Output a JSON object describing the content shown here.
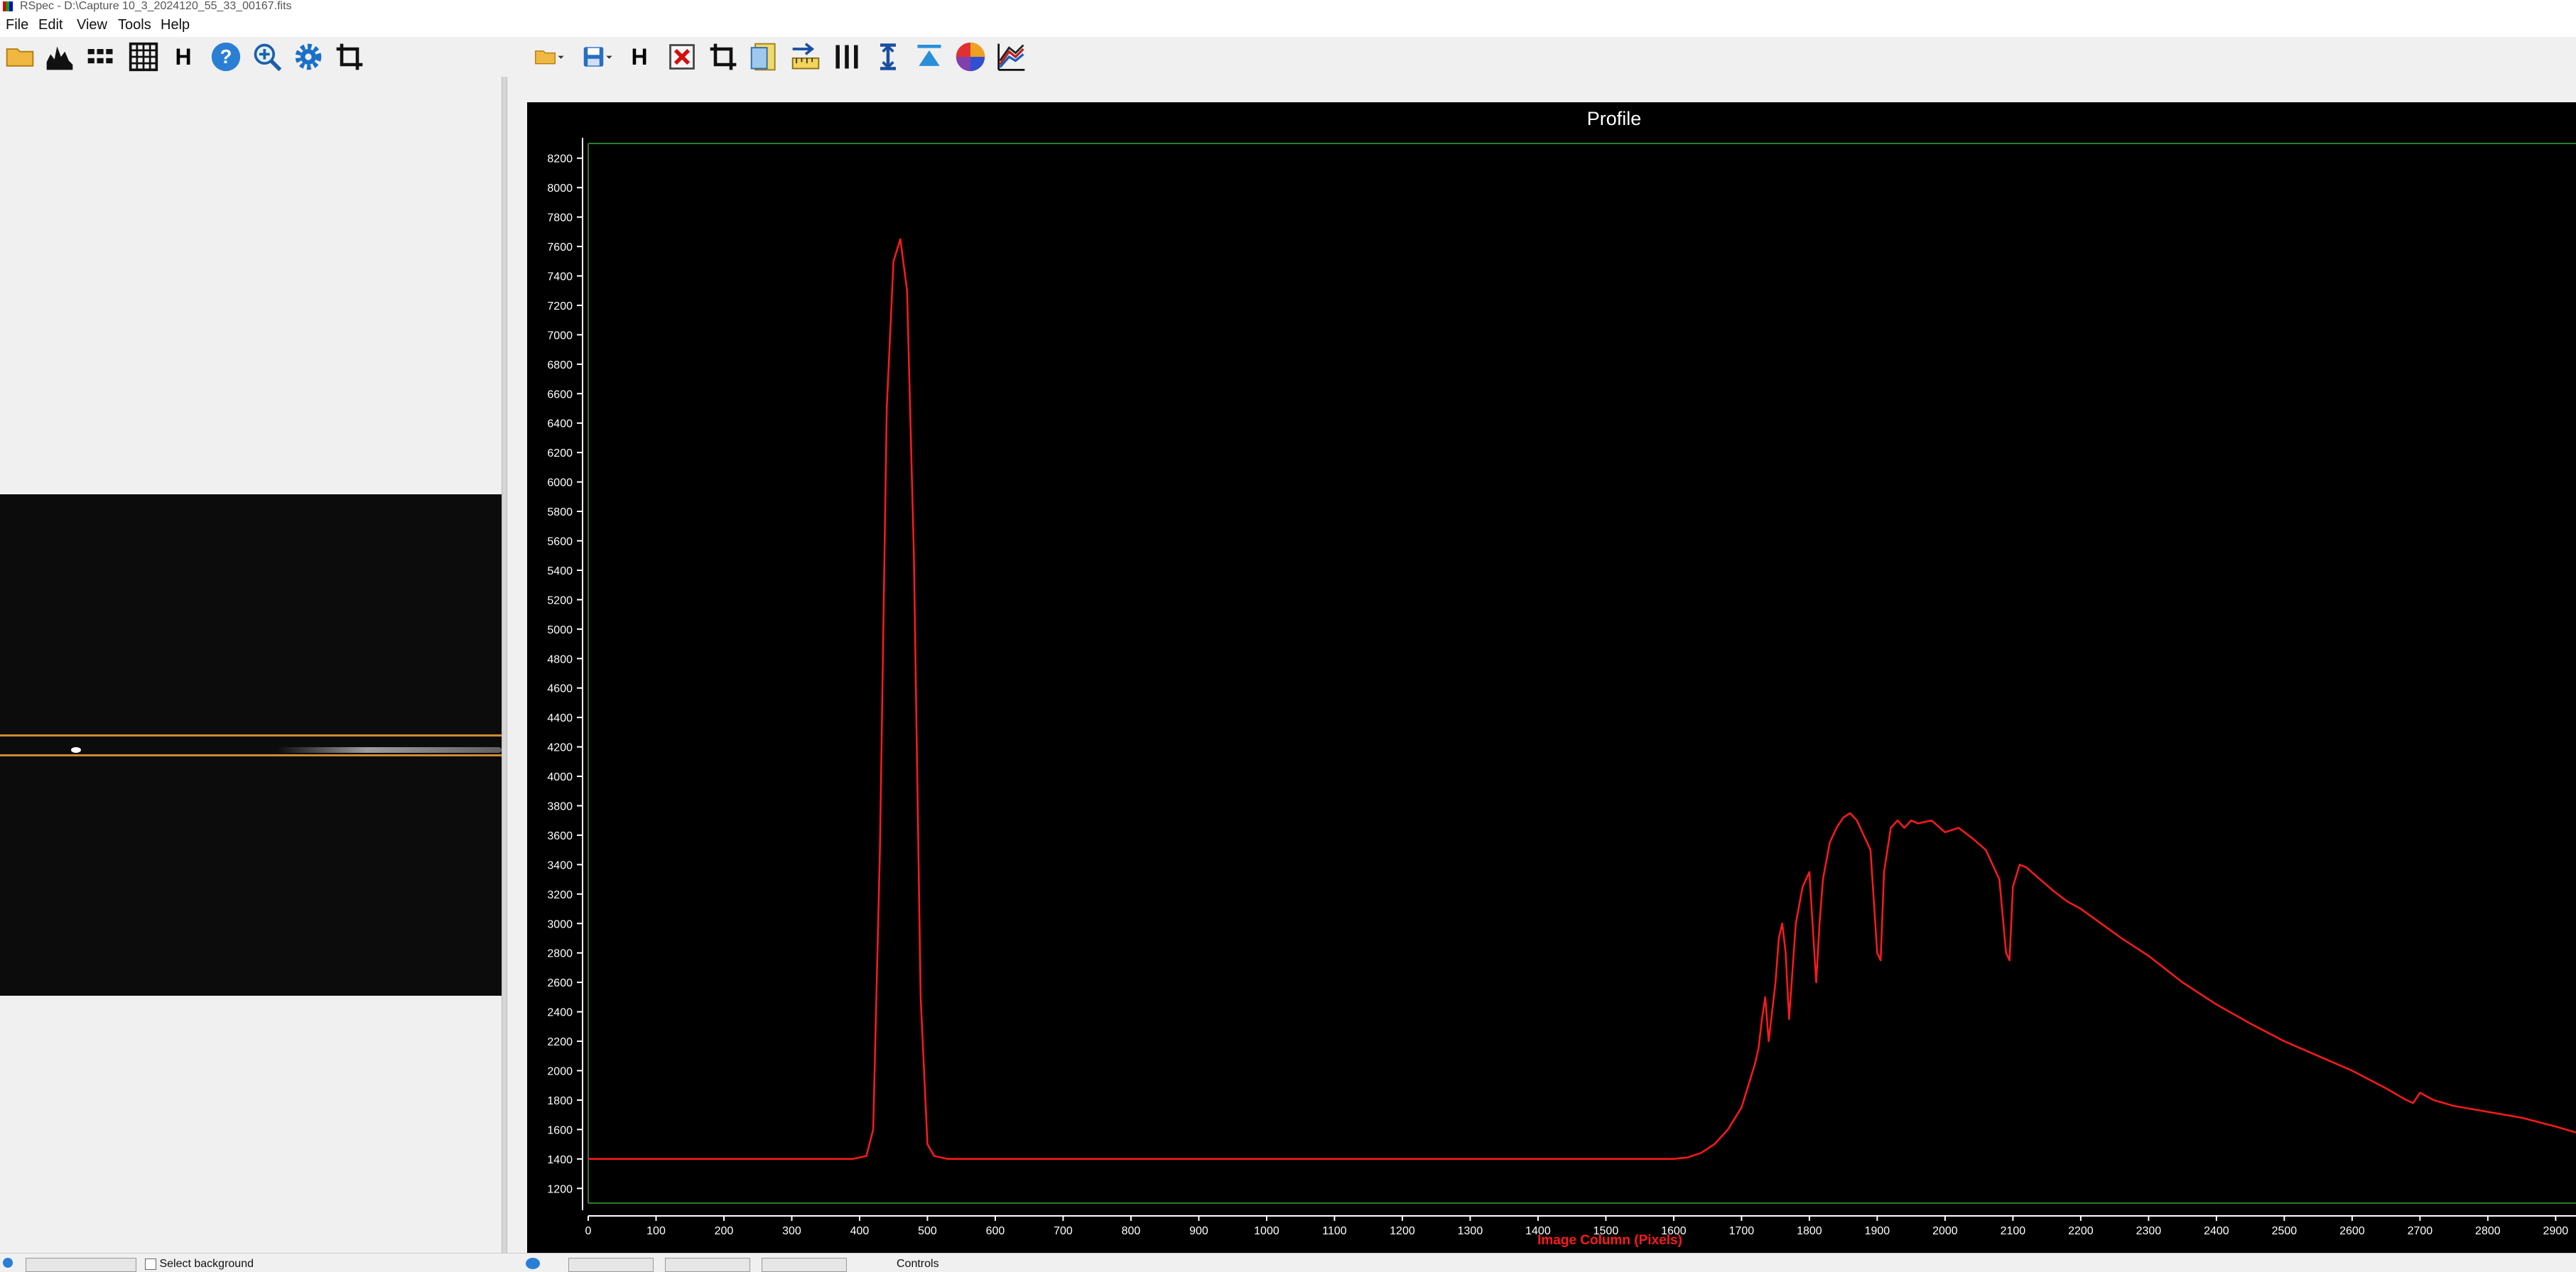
{
  "window": {
    "title": "RSpec - D:\\Capture 10_3_2024120_55_33_00167.fits"
  },
  "menu": [
    "File",
    "Edit",
    "View",
    "Tools",
    "Help"
  ],
  "left_toolbar": {
    "icons": [
      "open-folder-icon",
      "histogram-icon",
      "binning-grid-icon",
      "grid-icon",
      "H",
      "help-icon",
      "zoom-in-icon",
      "settings-gear-icon",
      "crop-icon"
    ],
    "h_label": "H"
  },
  "right_toolbar": {
    "icons": [
      "open-folder-icon",
      "save-disk-icon",
      "H",
      "delete-icon",
      "crop-icon",
      "notes-icon",
      "calibrate-ruler-icon",
      "vertical-lines-icon",
      "vertical-measure-icon",
      "arrow-up-icon",
      "color-wheel-icon",
      "stacked-lines-icon"
    ],
    "h_label": "H"
  },
  "bottom_bar": {
    "items": [
      "Select background",
      "Controls"
    ]
  },
  "colors": {
    "curve": "#ff1a1a",
    "grid_green": "#2f7a2f",
    "background": "#000000"
  },
  "chart_data": {
    "type": "line",
    "title": "Profile",
    "xlabel": "Image Column (Pixels)",
    "ylabel": "",
    "xlim": [
      0,
      2930
    ],
    "ylim": [
      1100,
      8300
    ],
    "x_ticks": [
      0,
      100,
      200,
      300,
      400,
      500,
      600,
      700,
      800,
      900,
      1000,
      1100,
      1200,
      1300,
      1400,
      1500,
      1600,
      1700,
      1800,
      1900,
      2000,
      2100,
      2200,
      2300,
      2400,
      2500,
      2600,
      2700,
      2800,
      2900
    ],
    "y_ticks": [
      1200,
      1400,
      1600,
      1800,
      2000,
      2200,
      2400,
      2600,
      2800,
      3000,
      3200,
      3400,
      3600,
      3800,
      4000,
      4200,
      4400,
      4600,
      4800,
      5000,
      5200,
      5400,
      5600,
      5800,
      6000,
      6200,
      6400,
      6600,
      6800,
      7000,
      7200,
      7400,
      7600,
      7800,
      8000,
      8200
    ],
    "series": [
      {
        "name": "",
        "x": [
          0,
          100,
          200,
          300,
          390,
          410,
          420,
          430,
          440,
          450,
          460,
          470,
          480,
          490,
          500,
          510,
          530,
          600,
          800,
          1000,
          1200,
          1400,
          1600,
          1620,
          1640,
          1660,
          1680,
          1700,
          1710,
          1720,
          1725,
          1730,
          1735,
          1740,
          1750,
          1755,
          1760,
          1765,
          1770,
          1780,
          1790,
          1800,
          1810,
          1815,
          1820,
          1830,
          1840,
          1850,
          1860,
          1870,
          1880,
          1890,
          1900,
          1905,
          1910,
          1920,
          1930,
          1940,
          1950,
          1960,
          1980,
          2000,
          2020,
          2040,
          2060,
          2080,
          2090,
          2095,
          2100,
          2110,
          2120,
          2140,
          2160,
          2180,
          2200,
          2230,
          2260,
          2300,
          2350,
          2400,
          2450,
          2500,
          2550,
          2600,
          2650,
          2680,
          2690,
          2700,
          2720,
          2750,
          2800,
          2850,
          2900,
          2930
        ],
        "values": [
          1400,
          1400,
          1400,
          1400,
          1400,
          1420,
          1600,
          3500,
          6500,
          7500,
          7650,
          7300,
          5500,
          2500,
          1500,
          1420,
          1400,
          1400,
          1400,
          1400,
          1400,
          1400,
          1400,
          1410,
          1440,
          1500,
          1600,
          1750,
          1900,
          2050,
          2150,
          2350,
          2500,
          2200,
          2600,
          2900,
          3000,
          2800,
          2350,
          3000,
          3250,
          3350,
          2600,
          3000,
          3300,
          3550,
          3650,
          3720,
          3750,
          3700,
          3600,
          3500,
          2800,
          2750,
          3350,
          3650,
          3700,
          3650,
          3700,
          3680,
          3700,
          3620,
          3650,
          3580,
          3500,
          3300,
          2800,
          2750,
          3250,
          3400,
          3380,
          3300,
          3220,
          3150,
          3100,
          3000,
          2900,
          2780,
          2600,
          2450,
          2320,
          2200,
          2100,
          2000,
          1880,
          1800,
          1780,
          1850,
          1800,
          1760,
          1720,
          1680,
          1620,
          1580
        ]
      }
    ],
    "grid": false
  }
}
